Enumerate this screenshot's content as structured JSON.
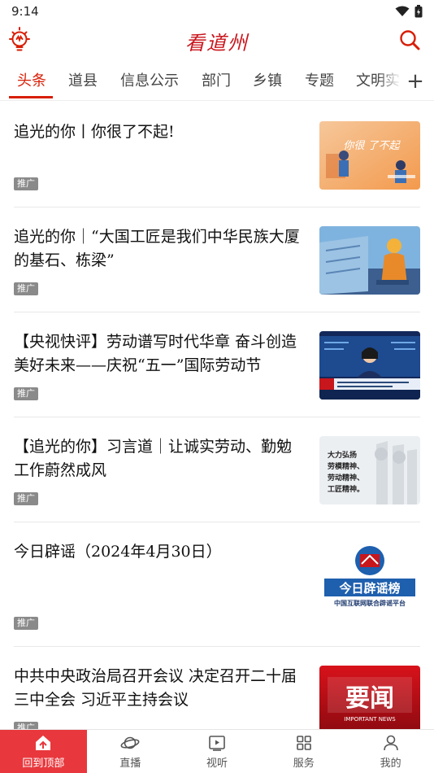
{
  "status_bar": {
    "time": "9:14"
  },
  "header": {
    "title": "看道州"
  },
  "tabs": [
    {
      "label": "头条",
      "active": true
    },
    {
      "label": "道县"
    },
    {
      "label": "信息公示"
    },
    {
      "label": "部门"
    },
    {
      "label": "乡镇"
    },
    {
      "label": "专题"
    },
    {
      "label": "文明实"
    }
  ],
  "feed": [
    {
      "title": "追光的你丨你很了不起!",
      "badge": "推广",
      "thumb_text": "你很 了不起"
    },
    {
      "title": "追光的你｜“大国工匠是我们中华民族大厦的基石、栋梁”",
      "badge": "推广"
    },
    {
      "title": "【央视快评】劳动谱写时代华章 奋斗创造美好未来——庆祝“五一”国际劳动节",
      "badge": "推广"
    },
    {
      "title": "【追光的你】习言道｜让诚实劳动、勤勉工作蔚然成风",
      "badge": "推广",
      "thumb_lines": [
        "大力弘扬",
        "劳模精神、",
        "劳动精神、",
        "工匠精神。"
      ]
    },
    {
      "title": "今日辟谣（2024年4月30日）",
      "badge": "推广",
      "thumb_main": "今日辟谣榜",
      "thumb_sub": "中国互联网联合辟谣平台"
    },
    {
      "title": "中共中央政治局召开会议 决定召开二十届三中全会 习近平主持会议",
      "badge": "推广",
      "thumb_main": "要闻",
      "thumb_sub": "IMPORTANT NEWS"
    }
  ],
  "bottom_nav": [
    {
      "label": "回到顶部",
      "icon": "home-top-icon",
      "active": true
    },
    {
      "label": "直播",
      "icon": "planet-icon"
    },
    {
      "label": "视听",
      "icon": "video-icon"
    },
    {
      "label": "服务",
      "icon": "grid-icon"
    },
    {
      "label": "我的",
      "icon": "user-icon"
    }
  ],
  "colors": {
    "accent": "#d81e06",
    "nav_active": "#e8383d",
    "badge": "#8a8a8a"
  }
}
